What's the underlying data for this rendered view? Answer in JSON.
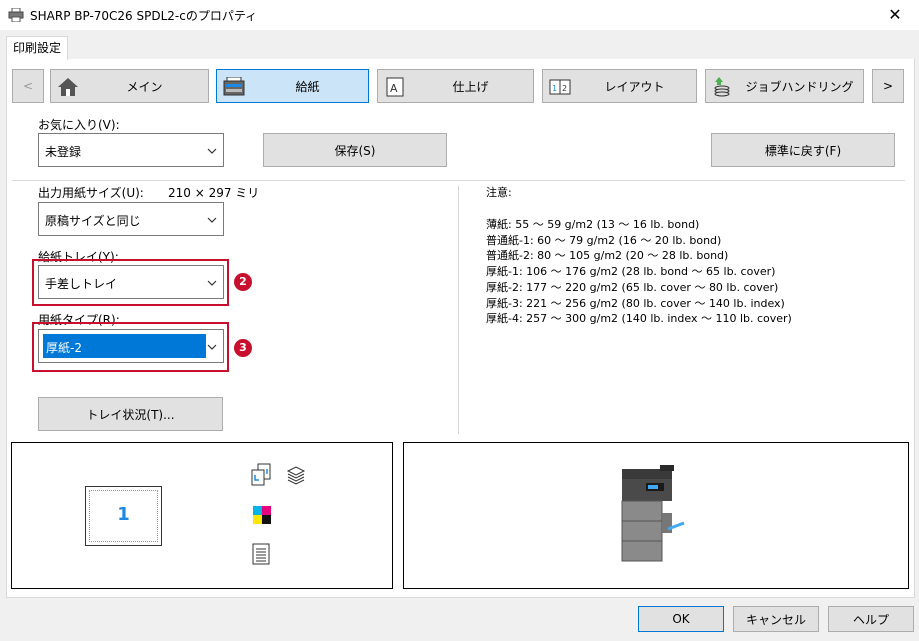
{
  "window": {
    "title": "SHARP BP-70C26 SPDL2-cのプロパティ",
    "close": "✕"
  },
  "tabs": {
    "active": "印刷設定"
  },
  "nav": {
    "prev": "<",
    "next": ">",
    "items": [
      {
        "label": "メイン",
        "icon": "home-icon"
      },
      {
        "label": "給紙",
        "icon": "paper-tray-icon",
        "selected": true
      },
      {
        "label": "仕上げ",
        "icon": "finishing-icon"
      },
      {
        "label": "レイアウト",
        "icon": "layout-icon"
      },
      {
        "label": "ジョブハンドリング",
        "icon": "job-handling-icon"
      }
    ]
  },
  "favorites": {
    "label": "お気に入り(V):",
    "value": "未登録",
    "save": "保存(S)",
    "reset": "標準に戻す(F)"
  },
  "output_paper": {
    "label": "出力用紙サイズ(U):",
    "dimensions": "210 × 297 ミリ",
    "value": "原稿サイズと同じ"
  },
  "paper_tray": {
    "label": "給紙トレイ(Y):",
    "value": "手差しトレイ",
    "badge": "2"
  },
  "paper_type": {
    "label": "用紙タイプ(R):",
    "value": "厚紙-2",
    "badge": "3"
  },
  "tray_status": {
    "label": "トレイ状況(T)..."
  },
  "notes": {
    "heading": "注意:",
    "lines": [
      "薄紙: 55 ～ 59 g/m2 (13 ～ 16 lb. bond)",
      "普通紙-1: 60 ～ 79 g/m2 (16 ～ 20 lb. bond)",
      "普通紙-2: 80 ～ 105 g/m2 (20 ～ 28 lb. bond)",
      "厚紙-1: 106 ～ 176 g/m2 (28 lb. bond ～ 65 lb. cover)",
      "厚紙-2: 177 ～ 220 g/m2 (65 lb. cover ～ 80 lb. cover)",
      "厚紙-3: 221 ～ 256 g/m2 (80 lb. cover ～ 140 lb. index)",
      "厚紙-4: 257 ～ 300 g/m2 (140 lb. index ～ 110 lb. cover)"
    ]
  },
  "preview": {
    "page_number": "1"
  },
  "footer": {
    "ok": "OK",
    "cancel": "キャンセル",
    "help": "ヘルプ"
  },
  "colors": {
    "accent": "#0078d7",
    "selected_bg": "#cce4f7",
    "annotation_red": "#c8102e",
    "page_number_blue": "#1e88e5"
  }
}
